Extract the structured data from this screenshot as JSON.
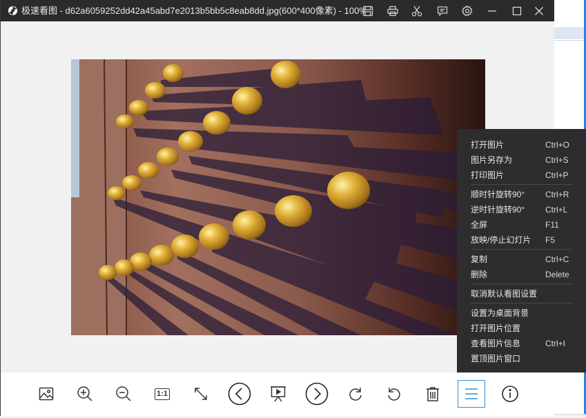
{
  "window": {
    "title": "极速看图 - d62a6059252dd42a45abd7e2013b5bb5c8eab8dd.jpg(600*400像素) - 100%"
  },
  "titlebar_icons": [
    "save-icon",
    "print-icon",
    "scissors-icon",
    "comment-icon",
    "gear-icon",
    "minimize-icon",
    "maximize-icon",
    "close-icon"
  ],
  "image": {
    "description_icon": "photo-of-golden-door-studs"
  },
  "toolbar": {
    "items": [
      {
        "name": "image-icon"
      },
      {
        "name": "zoom-in-icon"
      },
      {
        "name": "zoom-out-icon"
      },
      {
        "name": "actual-size",
        "label": "1:1"
      },
      {
        "name": "fit-window-icon"
      },
      {
        "name": "previous-icon"
      },
      {
        "name": "slideshow-icon"
      },
      {
        "name": "next-icon"
      },
      {
        "name": "rotate-clockwise-icon"
      },
      {
        "name": "rotate-counterclockwise-icon"
      },
      {
        "name": "delete-icon"
      },
      {
        "name": "menu-icon",
        "active": true
      },
      {
        "name": "info-icon"
      }
    ],
    "active_color": "#2f8fd1"
  },
  "menu": {
    "items": [
      {
        "label": "打开图片",
        "shortcut": "Ctrl+O"
      },
      {
        "label": "图片另存为",
        "shortcut": "Ctrl+S"
      },
      {
        "label": "打印图片",
        "shortcut": "Ctrl+P"
      },
      {
        "label": "顺时针旋转90°",
        "shortcut": "Ctrl+R"
      },
      {
        "label": "逆时针旋转90°",
        "shortcut": "Ctrl+L"
      },
      {
        "label": "全屏",
        "shortcut": "F11"
      },
      {
        "label": "放映/停止幻灯片",
        "shortcut": "F5"
      },
      {
        "label": "复制",
        "shortcut": "Ctrl+C"
      },
      {
        "label": "删除",
        "shortcut": "Delete"
      },
      {
        "label": "取消默认看图设置",
        "shortcut": ""
      },
      {
        "label": "设置为桌面背景",
        "shortcut": ""
      },
      {
        "label": "打开图片位置",
        "shortcut": ""
      },
      {
        "label": "查看图片信息",
        "shortcut": "Ctrl+I"
      },
      {
        "label": "置顶图片窗口",
        "shortcut": ""
      }
    ]
  }
}
